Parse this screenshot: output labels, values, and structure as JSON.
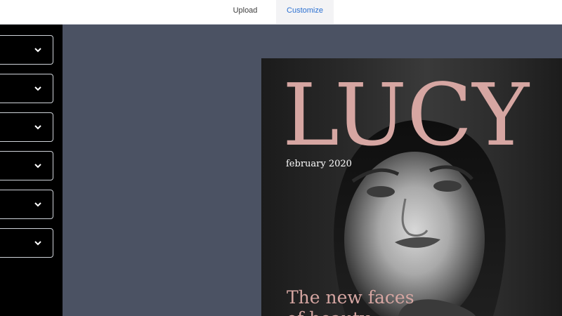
{
  "header": {
    "tabs": [
      {
        "label": "Upload",
        "active": false
      },
      {
        "label": "Customize",
        "active": true
      }
    ]
  },
  "sidebar": {
    "dropdowns": [
      {
        "value": "",
        "icon": "chevron-down-icon"
      },
      {
        "value": "",
        "icon": "chevron-down-icon"
      },
      {
        "value": "",
        "icon": "chevron-down-icon"
      },
      {
        "value": "",
        "icon": "chevron-down-icon"
      },
      {
        "value": "",
        "icon": "chevron-down-icon"
      },
      {
        "value": "",
        "icon": "chevron-down-icon"
      }
    ]
  },
  "cover": {
    "title": "LUCY",
    "date": "february 2020",
    "headline": "The new faces",
    "headline_line2": "of beauty",
    "accent_color": "#d6a6a2"
  },
  "colors": {
    "active_tab": "#2a6fd1",
    "canvas_bg": "#4b5263",
    "sidebar_bg": "#000000"
  }
}
